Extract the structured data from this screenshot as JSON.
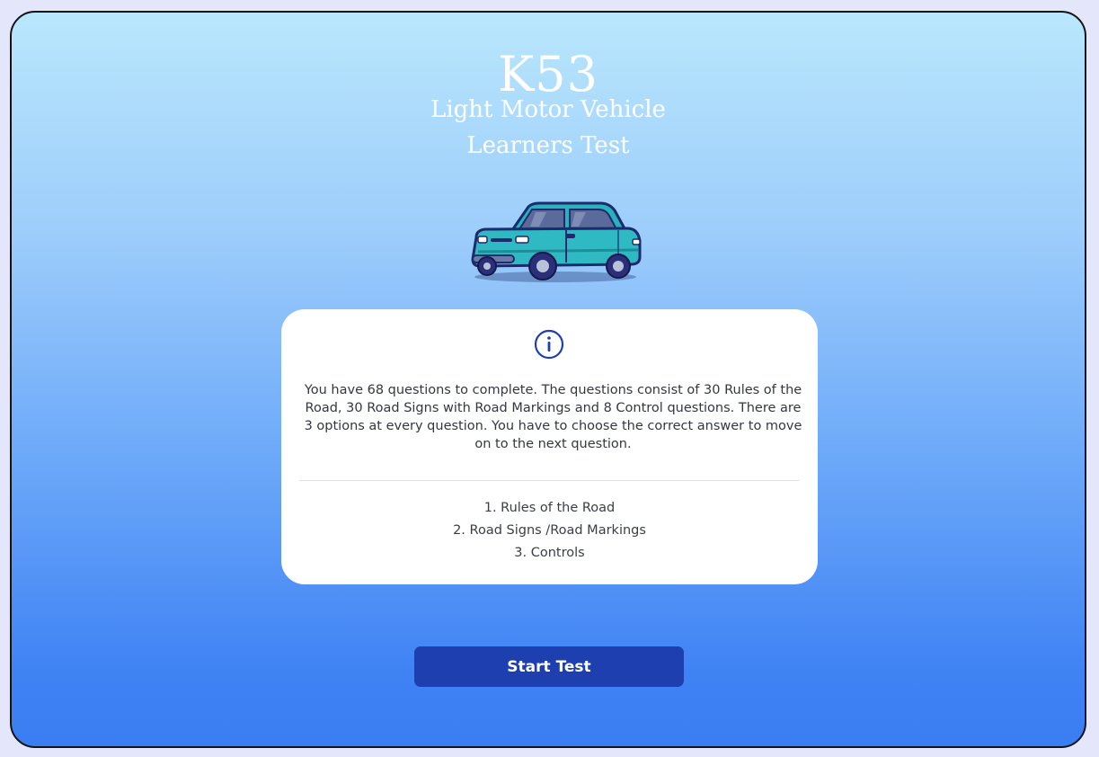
{
  "header": {
    "title": "K53",
    "subtitle_line1": "Light Motor Vehicle",
    "subtitle_line2": "Learners Test"
  },
  "hero": {
    "icon": "car-icon"
  },
  "info_card": {
    "icon": "info-icon",
    "description": "You have 68 questions to complete. The questions consist of 30 Rules of the Road, 30 Road Signs with Road Markings and 8 Control questions. There are 3 options at every question. You have to choose the correct answer to move on to the next question.",
    "sections": [
      "1. Rules of the Road",
      "2. Road Signs /Road Markings",
      "3. Controls"
    ]
  },
  "actions": {
    "start_label": "Start Test"
  },
  "colors": {
    "accent": "#1e3fb0",
    "background_top": "#b9e7fd",
    "background_bottom": "#3a7ef3",
    "card": "#ffffff"
  }
}
